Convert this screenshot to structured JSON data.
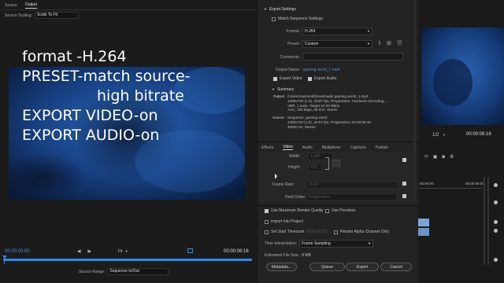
{
  "left_panel": {
    "tabs": [
      "Source",
      "Output"
    ],
    "scaling_label": "Source Scaling:",
    "scaling_value": "Scale To Fit",
    "overlay_lines": [
      "format -H.264",
      "PRESET-match source-",
      "high bitrate",
      "EXPORT VIDEO-on",
      "EXPORT AUDIO-on"
    ],
    "timecode_start": "00:00:00:00",
    "timecode_end": "00:00:06:16",
    "fit_value": "Fit",
    "source_range_label": "Source Range:",
    "source_range_value": "Sequence In/Out"
  },
  "export_settings": {
    "section_title": "Export Settings",
    "match_sequence_label": "Match Sequence Settings",
    "format_label": "Format:",
    "format_value": "H.264",
    "preset_label": "Preset:",
    "preset_value": "Custom",
    "comments_label": "Comments:",
    "output_name_label": "Output Name:",
    "output_name_value": "gaming world_1.mp4",
    "export_video_label": "Export Video",
    "export_audio_label": "Export Audio",
    "summary_title": "Summary",
    "output_label": "Output:",
    "output_lines": [
      "/Users/macbook/Downloads/ gaming world_1.mp4",
      "1280x720 (1.0), 29.97 fps, Progressive, Hardware Encoding,...",
      "VBR, 1 pass, Target 10.00 Mbps",
      "AAC, 320 kbps, 48 kHz, Stereo"
    ],
    "source_label": "Source:",
    "source_lines": [
      "Sequence, gaming world",
      "1280x720 (1.0), 29.97 fps, Progressive, 00:00:06:16",
      "48000 Hz, Stereo"
    ]
  },
  "settings_tabs": [
    "Effects",
    "Video",
    "Audio",
    "Multiplexer",
    "Captions",
    "Publish"
  ],
  "video_settings": {
    "width_label": "Width:",
    "width_value": "1,280",
    "height_label": "Height:",
    "height_value": "720",
    "frame_rate_label": "Frame Rate:",
    "frame_rate_value": "29.97",
    "field_order_label": "Field Order:",
    "field_order_value": "Progressive"
  },
  "bottom_options": {
    "max_render_quality": "Use Maximum Render Quality",
    "use_previews": "Use Previews",
    "import_into_project": "Import Into Project",
    "set_start_timecode": "Set Start Timecode",
    "start_timecode_value": "00;00;00;00",
    "render_alpha": "Render Alpha Channel Only",
    "time_interpolation_label": "Time Interpolation:",
    "time_interpolation_value": "Frame Sampling",
    "estimated_size_label": "Estimated File Size:",
    "estimated_size_value": "8 MB",
    "buttons": [
      "Metadata...",
      "Queue",
      "Export",
      "Cancel"
    ]
  },
  "right_panel": {
    "zoom_value": "1/2",
    "timecode": "00:00:06:16",
    "timeline_timecodes": [
      "00:06:00",
      "00:00:08:00"
    ]
  },
  "colors": {
    "accent": "#2d8ceb",
    "panel_bg": "#1e1e1e",
    "preview_blue": "#1b4f96"
  }
}
